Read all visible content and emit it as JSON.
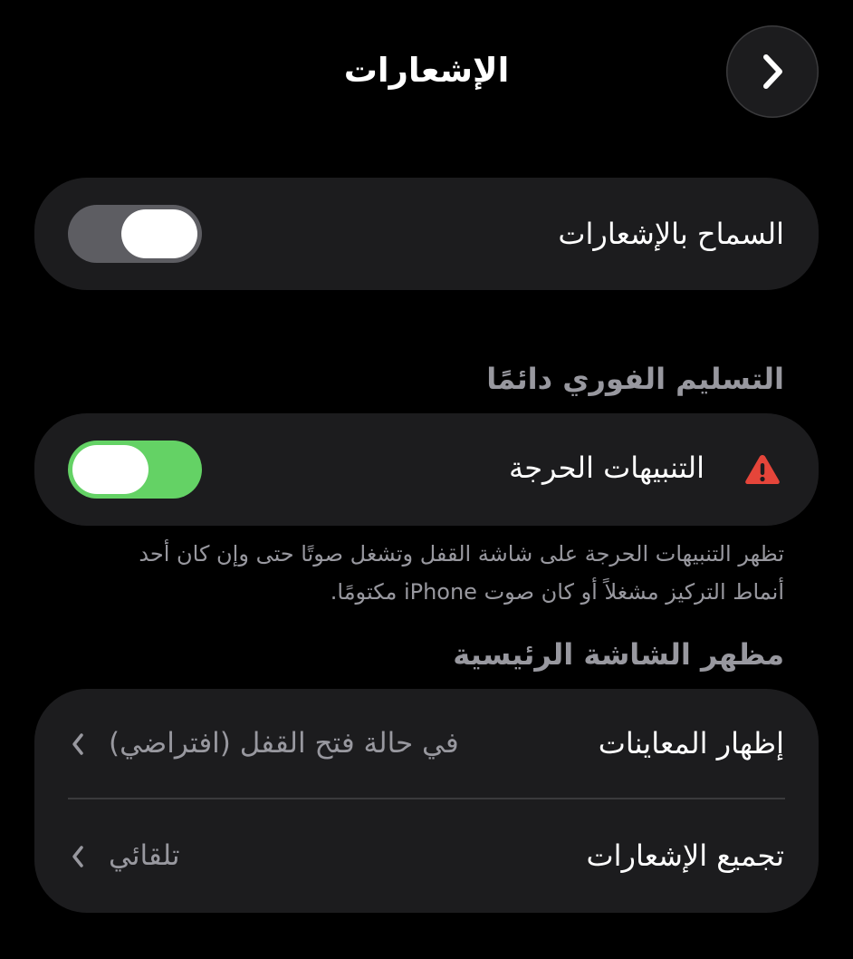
{
  "header": {
    "title": "الإشعارات",
    "back_icon": "chevron-right-icon"
  },
  "allow_notifications": {
    "label": "السماح بالإشعارات",
    "enabled": false
  },
  "immediate_delivery": {
    "section_title": "التسليم الفوري دائمًا",
    "critical_alerts": {
      "label": "التنبيهات الحرجة",
      "icon": "warning-triangle-icon",
      "icon_color": "#e5453a",
      "enabled": true
    },
    "footer": "تظهر التنبيهات الحرجة على شاشة القفل وتشغل صوتًا حتى وإن كان أحد أنماط التركيز مشغلاً أو كان صوت iPhone مكتومًا."
  },
  "lock_screen": {
    "section_title": "مظهر الشاشة الرئيسية",
    "rows": [
      {
        "label": "إظهار المعاينات",
        "value": "في حالة فتح القفل (افتراضي)"
      },
      {
        "label": "تجميع الإشعارات",
        "value": "تلقائي"
      }
    ]
  },
  "colors": {
    "background": "#000000",
    "card": "#1c1c1e",
    "toggle_on": "#64d265",
    "toggle_off": "#5d5d62",
    "secondary_text": "#98989f"
  }
}
